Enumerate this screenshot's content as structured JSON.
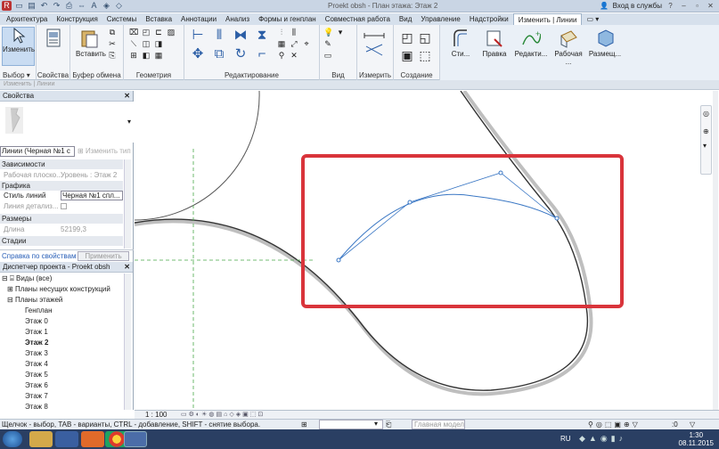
{
  "titlebar": {
    "title": "Proekt obsh - План этажа: Этаж 2",
    "signin": "Вход в службы"
  },
  "tabs": [
    "Архитектура",
    "Конструкция",
    "Системы",
    "Вставка",
    "Аннотации",
    "Анализ",
    "Формы и генплан",
    "Совместная работа",
    "Вид",
    "Управление",
    "Надстройки",
    "Изменить | Линии"
  ],
  "ribbon": {
    "modify_label": "Изменить",
    "select_label": "Выбор",
    "properties_label": "Свойства",
    "paste_label": "Вставить",
    "clipboard_label": "Буфер обмена",
    "geometry_label": "Геометрия",
    "modify_panel_label": "Редактирование",
    "view_label": "Вид",
    "measure_label": "Измерить",
    "create_label": "Создание",
    "btn_style": "Сти...",
    "btn_edit": "Правка",
    "btn_redit": "Редакти...",
    "btn_work": "Рабочая ...",
    "btn_place": "Размещ..."
  },
  "optionsbar": {
    "text": "Изменить | Линии"
  },
  "properties": {
    "header": "Свойства",
    "type_selector": "Линии (Черная №1 с",
    "edit_type": "Изменить тип",
    "sections": {
      "constraints": "Зависимости",
      "graphics": "Графика",
      "dimensions": "Размеры",
      "phases": "Стадии"
    },
    "rows": {
      "work_plane_k": "Рабочая плоско...",
      "work_plane_v": "Уровень : Этаж 2",
      "line_style_k": "Стиль линий",
      "line_style_v": "Черная №1 спл...",
      "detail_line_k": "Линия детализ...",
      "length_k": "Длина",
      "length_v": "52199,3"
    },
    "help_link": "Справка по свойствам",
    "apply_button": "Применить"
  },
  "project_browser": {
    "header": "Диспетчер проекта - Proekt obsh",
    "items": [
      "Виды (все)",
      "Планы несущих конструкций",
      "Планы этажей",
      "Генплан",
      "Этаж 0",
      "Этаж 1",
      "Этаж 2",
      "Этаж 3",
      "Этаж 4",
      "Этаж 5",
      "Этаж 6",
      "Этаж 7",
      "Этаж 8"
    ]
  },
  "viewbar": {
    "scale": "1 : 100"
  },
  "statusbar": {
    "text": "Щелчок - выбор, TAB - варианты, CTRL - добавление, SHIFT - снятие выбора.",
    "model": "Главная модел",
    "zero": ":0"
  },
  "taskbar": {
    "lang": "RU",
    "time": "1:30",
    "date": "08.11.2015"
  },
  "colors": {
    "highlight": "#d9343b",
    "selected": "#3a77c4",
    "ribbon_bg": "#f3f5f8"
  }
}
